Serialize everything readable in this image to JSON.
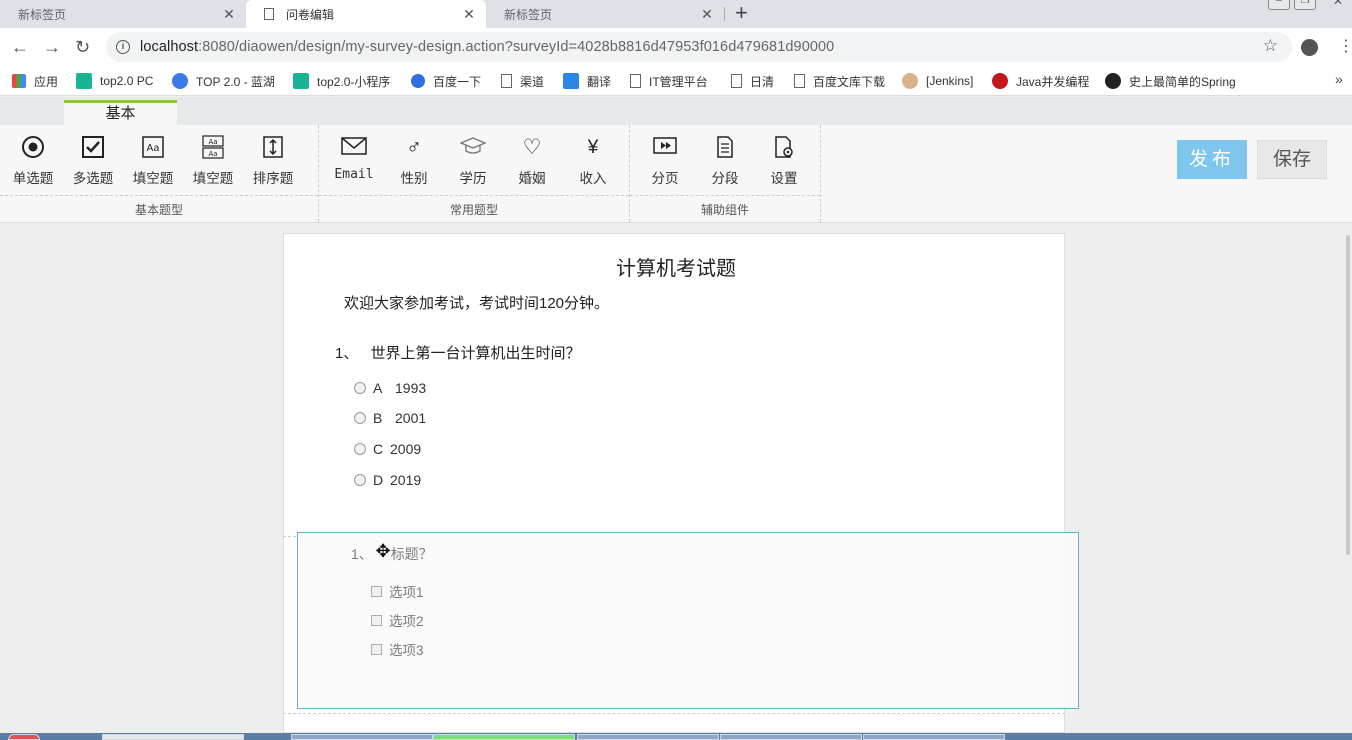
{
  "browser": {
    "tabs": [
      {
        "title": "新标签页",
        "active": false
      },
      {
        "title": "问卷编辑",
        "active": true
      },
      {
        "title": "新标签页",
        "active": false
      }
    ],
    "new_tab_symbol": "+",
    "url_host": "localhost",
    "url_rest": ":8080/diaowen/design/my-survey-design.action?surveyId=4028b8816d47953f016d479681d90000",
    "bookmarks": [
      {
        "label": "应用",
        "icon": "apps-grid-icon"
      },
      {
        "label": "top2.0 PC",
        "icon": "green-play-icon"
      },
      {
        "label": "TOP 2.0 - 蓝湖",
        "icon": "lanhu-icon"
      },
      {
        "label": "top2.0-小程序",
        "icon": "green-play-icon"
      },
      {
        "label": "百度一下",
        "icon": "baidu-paw-icon"
      },
      {
        "label": "渠道",
        "icon": "page-icon"
      },
      {
        "label": "翻译",
        "icon": "translate-icon"
      },
      {
        "label": "IT管理平台",
        "icon": "page-icon"
      },
      {
        "label": "日清",
        "icon": "page-icon"
      },
      {
        "label": "百度文库下载",
        "icon": "page-icon"
      },
      {
        "label": "[Jenkins]",
        "icon": "jenkins-icon"
      },
      {
        "label": "Java并发编程",
        "icon": "csdn-icon"
      },
      {
        "label": "史上最简单的Spring",
        "icon": "github-icon"
      }
    ],
    "bookmarks_overflow": "»"
  },
  "ribbon": {
    "tab_label": "基本",
    "groups": [
      {
        "label": "基本题型",
        "items": [
          {
            "label": "单选题",
            "icon": "radio-icon"
          },
          {
            "label": "多选题",
            "icon": "checkbox-icon"
          },
          {
            "label": "填空题",
            "icon": "text-fill-icon"
          },
          {
            "label": "填空题",
            "icon": "multi-fill-icon"
          },
          {
            "label": "排序题",
            "icon": "sort-icon"
          }
        ]
      },
      {
        "label": "常用题型",
        "items": [
          {
            "label": "Email",
            "icon": "email-icon"
          },
          {
            "label": "性别",
            "icon": "gender-icon"
          },
          {
            "label": "学历",
            "icon": "graduation-cap-icon"
          },
          {
            "label": "婚姻",
            "icon": "heart-icon"
          },
          {
            "label": "收入",
            "icon": "yen-icon"
          }
        ]
      },
      {
        "label": "辅助组件",
        "items": [
          {
            "label": "分页",
            "icon": "pagination-icon"
          },
          {
            "label": "分段",
            "icon": "paragraph-icon"
          },
          {
            "label": "设置",
            "icon": "settings-icon"
          }
        ]
      }
    ],
    "publish_label": "发布",
    "save_label": "保存"
  },
  "survey": {
    "title": "计算机考试题",
    "description": "欢迎大家参加考试，考试时间120分钟。",
    "questions": [
      {
        "number": "1、",
        "text": "世界上第一台计算机出生时间？",
        "options": [
          {
            "letter": "A",
            "value": "1993"
          },
          {
            "letter": "B",
            "value": "2001"
          },
          {
            "letter": "C",
            "value": "2009"
          },
          {
            "letter": "D",
            "value": "2019"
          }
        ]
      }
    ],
    "dragging_question": {
      "number": "1、",
      "text": "标题？",
      "options": [
        "选项1",
        "选项2",
        "选项3"
      ]
    }
  },
  "colors": {
    "ribbon_active": "#8cc63f",
    "publish_bg": "#7fc6ee",
    "drag_border": "#5ab1bf"
  }
}
